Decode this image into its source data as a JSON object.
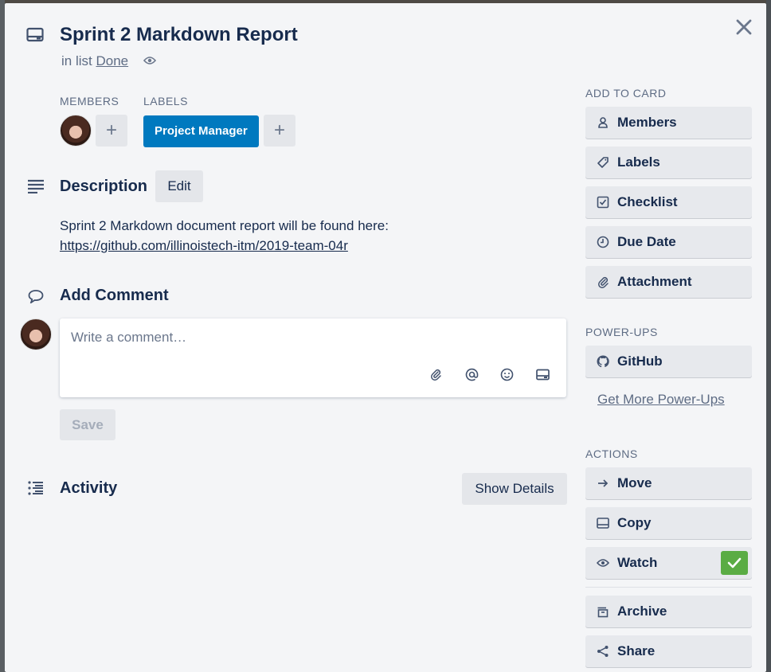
{
  "card": {
    "title": "Sprint 2 Markdown Report",
    "in_list_prefix": "in list",
    "list_name": "Done"
  },
  "sections": {
    "members_label": "MEMBERS",
    "labels_label": "LABELS",
    "add_symbol": "+",
    "label_pill": "Project Manager"
  },
  "description": {
    "heading": "Description",
    "edit_label": "Edit",
    "text": "Sprint 2 Markdown document report will be found here:",
    "link": "https://github.com/illinoistech-itm/2019-team-04r"
  },
  "comment": {
    "heading": "Add Comment",
    "placeholder": "Write a comment…",
    "save_label": "Save",
    "icons": [
      "attachment-icon",
      "mention-icon",
      "emoji-icon",
      "card-icon"
    ]
  },
  "activity": {
    "heading": "Activity",
    "show_details_label": "Show Details"
  },
  "sidebar": {
    "add_to_card_label": "ADD TO CARD",
    "add_to_card": [
      {
        "label": "Members",
        "icon": "person-icon"
      },
      {
        "label": "Labels",
        "icon": "tag-icon"
      },
      {
        "label": "Checklist",
        "icon": "checkbox-icon"
      },
      {
        "label": "Due Date",
        "icon": "clock-icon"
      },
      {
        "label": "Attachment",
        "icon": "paperclip-icon"
      }
    ],
    "power_ups_label": "POWER-UPS",
    "github_label": "GitHub",
    "get_more_label": "Get More Power-Ups",
    "actions_label": "ACTIONS",
    "actions": [
      {
        "label": "Move",
        "icon": "arrow-right-icon"
      },
      {
        "label": "Copy",
        "icon": "card-icon"
      },
      {
        "label": "Watch",
        "icon": "eye-icon",
        "checked": true
      },
      {
        "label": "Archive",
        "icon": "archive-icon"
      },
      {
        "label": "Share",
        "icon": "share-icon"
      }
    ]
  },
  "colors": {
    "label_blue": "#0079bf",
    "watch_green": "#5aac44",
    "modal_bg": "#f4f5f7"
  }
}
